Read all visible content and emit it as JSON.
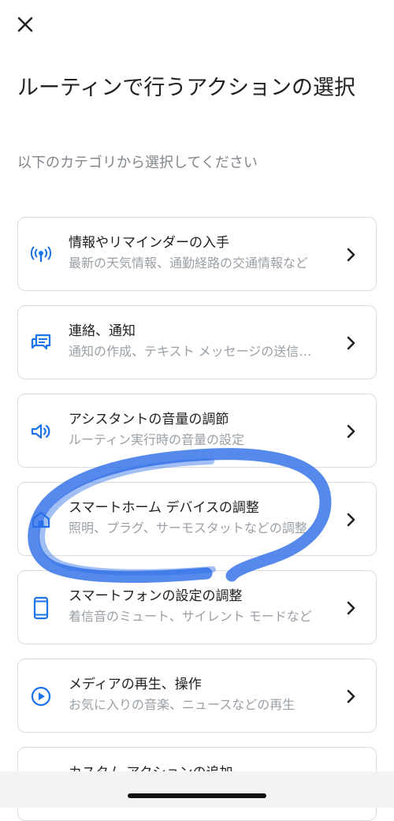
{
  "header": {
    "title": "ルーティンで行うアクションの選択",
    "subtitle": "以下のカテゴリから選択してください"
  },
  "categories": [
    {
      "label": "情報やリマインダーの入手",
      "desc": "最新の天気情報、通勤経路の交通情報など",
      "icon": "broadcast-icon"
    },
    {
      "label": "連絡、通知",
      "desc": "通知の作成、テキスト メッセージの送信など",
      "icon": "chat-icon"
    },
    {
      "label": "アシスタントの音量の調節",
      "desc": "ルーティン実行時の音量の設定",
      "icon": "volume-icon"
    },
    {
      "label": "スマートホーム デバイスの調整",
      "desc": "照明、プラグ、サーモスタットなどの調整",
      "icon": "home-icon"
    },
    {
      "label": "スマートフォンの設定の調整",
      "desc": "着信音のミュート、サイレント モードなど",
      "icon": "phone-icon"
    },
    {
      "label": "メディアの再生、操作",
      "desc": "お気に入りの音楽、ニュースなどの再生",
      "icon": "play-icon"
    },
    {
      "label": "カスタム アクションの追加",
      "desc": "",
      "icon": "add-icon"
    }
  ],
  "colors": {
    "accent": "#1a73e8",
    "annotation": "#2f6fe8"
  }
}
